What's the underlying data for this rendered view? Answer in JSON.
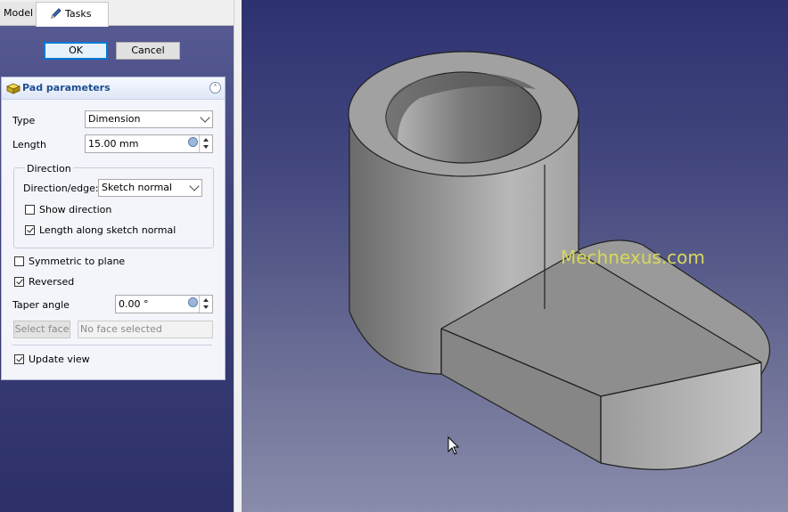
{
  "tabs": {
    "model": "Model",
    "tasks": "Tasks"
  },
  "buttons": {
    "ok": "OK",
    "cancel": "Cancel"
  },
  "panel": {
    "title": "Pad parameters",
    "type_label": "Type",
    "type_value": "Dimension",
    "length_label": "Length",
    "length_value": "15.00 mm",
    "direction_group": "Direction",
    "direction_edge_label": "Direction/edge:",
    "direction_edge_value": "Sketch normal",
    "show_direction": "Show direction",
    "length_along": "Length along sketch normal",
    "symmetric": "Symmetric to plane",
    "reversed": "Reversed",
    "taper_label": "Taper angle",
    "taper_value": "0.00 °",
    "select_face": "Select face",
    "no_face": "No face selected",
    "update_view": "Update view"
  },
  "checks": {
    "show_direction": false,
    "length_along": true,
    "symmetric": false,
    "reversed": true,
    "update_view": true
  },
  "watermark": "Mechnexus.com",
  "colors": {
    "accent": "#1d4f91",
    "model_face": "#9c9c9c"
  }
}
